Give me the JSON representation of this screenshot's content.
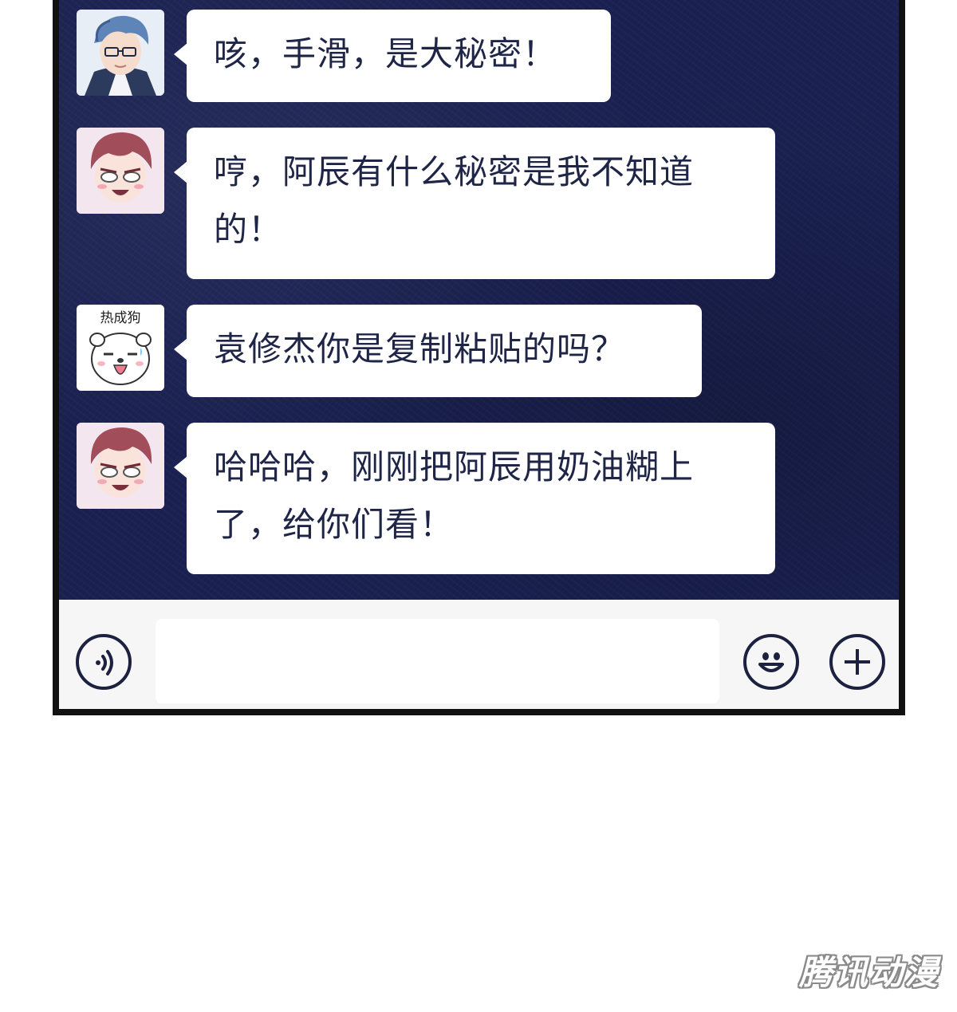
{
  "colors": {
    "chat_background": "#1b2253",
    "bubble": "#ffffff",
    "bubble_text": "#1f2547",
    "input_bar": "#f6f6f6",
    "border": "#111111"
  },
  "messages": [
    {
      "avatar": "blue-haired-glasses-avatar",
      "text": "咳，手滑，是大秘密！"
    },
    {
      "avatar": "red-haired-smiling-avatar",
      "text": "哼，阿辰有什么秘密是我不知道的！"
    },
    {
      "avatar": "dog-sticker-avatar",
      "avatar_caption": "热成狗",
      "text": "袁修杰你是复制粘贴的吗？"
    },
    {
      "avatar": "red-haired-smiling-avatar",
      "text": "哈哈哈，刚刚把阿辰用奶油糊上了，给你们看！"
    }
  ],
  "input_bar": {
    "voice_icon": "voice-icon",
    "emoji_icon": "emoji-icon",
    "add_icon": "plus-icon",
    "input_value": ""
  },
  "watermark": "腾讯动漫"
}
